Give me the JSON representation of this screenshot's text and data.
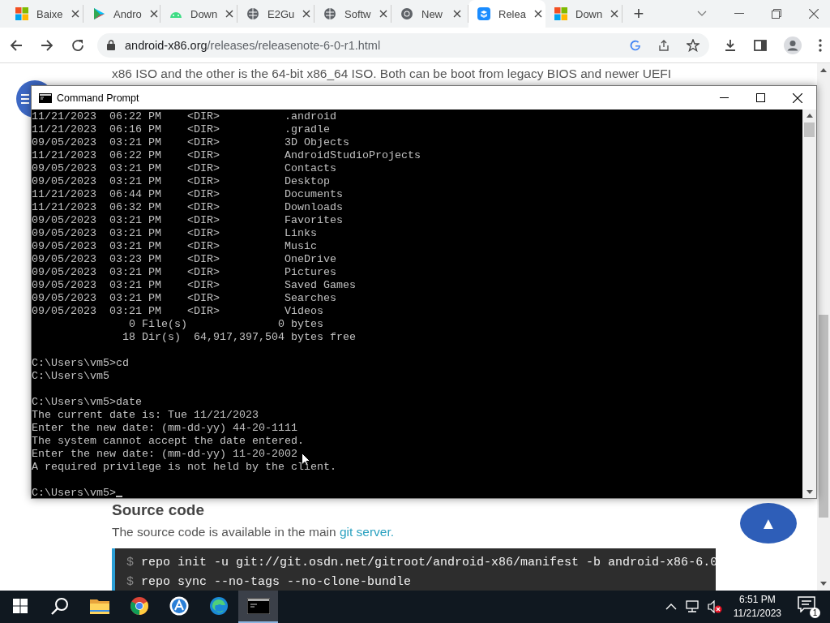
{
  "browser": {
    "tabs": [
      {
        "title": "Baixe",
        "kind": "windows",
        "selected": false
      },
      {
        "title": "Andro",
        "kind": "play",
        "selected": false
      },
      {
        "title": "Down",
        "kind": "android",
        "selected": false
      },
      {
        "title": "E2Gu",
        "kind": "globe",
        "selected": false
      },
      {
        "title": "Softw",
        "kind": "globe",
        "selected": false
      },
      {
        "title": "New",
        "kind": "chrome",
        "selected": false
      },
      {
        "title": "Relea",
        "kind": "app",
        "selected": true
      },
      {
        "title": "Down",
        "kind": "windows",
        "selected": false
      }
    ],
    "new_tab": "+",
    "url_domain": "android-x86.org",
    "url_path": "/releases/releasenote-6-0-r1.html"
  },
  "page": {
    "intro_lines": [
      "x86 ISO and the other is the 64-bit x86_64 ISO. Both can be boot from legacy BIOS and newer UEFI"
    ],
    "heading": "Source code",
    "paragraph": "The source code is available in the main",
    "link": "git server.",
    "code_lines": [
      {
        "prompt": "$",
        "command": "repo init -u git://git.osdn.net/gitroot/android-x86/manifest -b android-x86-6.0"
      },
      {
        "prompt": "$",
        "command": "repo sync --no-tags --no-clone-bundle"
      }
    ],
    "scroll_top": "▲"
  },
  "cmd": {
    "title": "Command Prompt",
    "blocks": [
      [
        "11/21/2023  06:22 PM    <DIR>          .android",
        "11/21/2023  06:16 PM    <DIR>          .gradle",
        "09/05/2023  03:21 PM    <DIR>          3D Objects",
        "11/21/2023  06:22 PM    <DIR>          AndroidStudioProjects",
        "09/05/2023  03:21 PM    <DIR>          Contacts",
        "09/05/2023  03:21 PM    <DIR>          Desktop",
        "11/21/2023  06:44 PM    <DIR>          Documents",
        "11/21/2023  06:32 PM    <DIR>          Downloads",
        "09/05/2023  03:21 PM    <DIR>          Favorites",
        "09/05/2023  03:21 PM    <DIR>          Links",
        "09/05/2023  03:21 PM    <DIR>          Music",
        "09/05/2023  03:23 PM    <DIR>          OneDrive",
        "09/05/2023  03:21 PM    <DIR>          Pictures",
        "09/05/2023  03:21 PM    <DIR>          Saved Games",
        "09/05/2023  03:21 PM    <DIR>          Searches",
        "09/05/2023  03:21 PM    <DIR>          Videos",
        "               0 File(s)              0 bytes",
        "              18 Dir(s)  64,917,397,504 bytes free"
      ],
      [
        "C:\\Users\\vm5>cd",
        "C:\\Users\\vm5"
      ],
      [
        "C:\\Users\\vm5>date",
        "The current date is: Tue 11/21/2023",
        "Enter the new date: (mm-dd-yy) 44-20-1111",
        "The system cannot accept the date entered.",
        "Enter the new date: (mm-dd-yy) 11-20-2002",
        "A required privilege is not held by the client."
      ],
      [
        "C:\\Users\\vm5>"
      ]
    ]
  },
  "taskbar": {
    "apps": [
      {
        "kind": "start",
        "selected": false
      },
      {
        "kind": "search",
        "selected": false
      },
      {
        "kind": "folder",
        "selected": false
      },
      {
        "kind": "chrome",
        "selected": false
      },
      {
        "kind": "appstore",
        "selected": false
      },
      {
        "kind": "edge",
        "selected": false
      },
      {
        "kind": "terminal",
        "selected": true
      }
    ],
    "time": "6:51 PM",
    "date": "11/21/2023",
    "notifications": "1"
  }
}
